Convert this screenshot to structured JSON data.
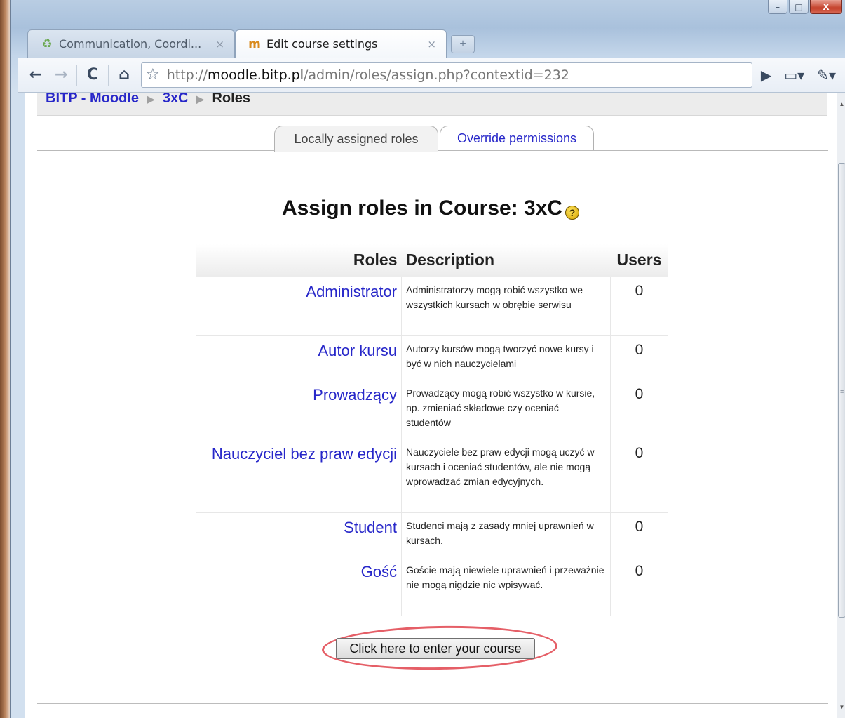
{
  "window": {
    "controls": {
      "minimize": "–",
      "maximize": "□",
      "close": "X"
    }
  },
  "tabs": [
    {
      "label": "Communication, Coordi...",
      "icon": "recycle-icon",
      "active": false
    },
    {
      "label": "Edit course settings",
      "icon": "moodle-icon",
      "active": true
    }
  ],
  "toolbar": {
    "url_prefix": "http://",
    "url_host": "moodle.bitp.pl",
    "url_path": "/admin/roles/assign.php?contextid=232"
  },
  "breadcrumb": {
    "items": [
      "BITP - Moodle",
      "3xC",
      "Roles"
    ]
  },
  "page_tabs": {
    "current": "Locally assigned roles",
    "other": "Override permissions"
  },
  "heading": "Assign roles in Course: 3xC",
  "table": {
    "headers": [
      "Roles",
      "Description",
      "Users"
    ],
    "rows": [
      {
        "role": "Administrator",
        "description": "Administratorzy mogą robić wszystko we wszystkich kursach w obrębie serwisu",
        "users": "0"
      },
      {
        "role": "Autor kursu",
        "description": "Autorzy kursów mogą tworzyć nowe kursy i być w nich nauczycielami",
        "users": "0"
      },
      {
        "role": "Prowadzący",
        "description": "Prowadzący mogą robić wszystko w kursie, np. zmieniać składowe czy oceniać studentów",
        "users": "0"
      },
      {
        "role": "Nauczyciel bez praw edycji",
        "description": "Nauczyciele bez praw edycji mogą uczyć w kursach i oceniać studentów, ale nie mogą wprowadzać zmian edycyjnych.",
        "users": "0"
      },
      {
        "role": "Student",
        "description": "Studenci mają z zasady mniej uprawnień w kursach.",
        "users": "0"
      },
      {
        "role": "Gość",
        "description": "Goście mają niewiele uprawnień i przeważnie nie mogą nigdzie nic wpisywać.",
        "users": "0"
      }
    ]
  },
  "enter_button": "Click here to enter your course",
  "colors": {
    "link": "#2727c9",
    "highlight_oval": "#e0434c"
  }
}
